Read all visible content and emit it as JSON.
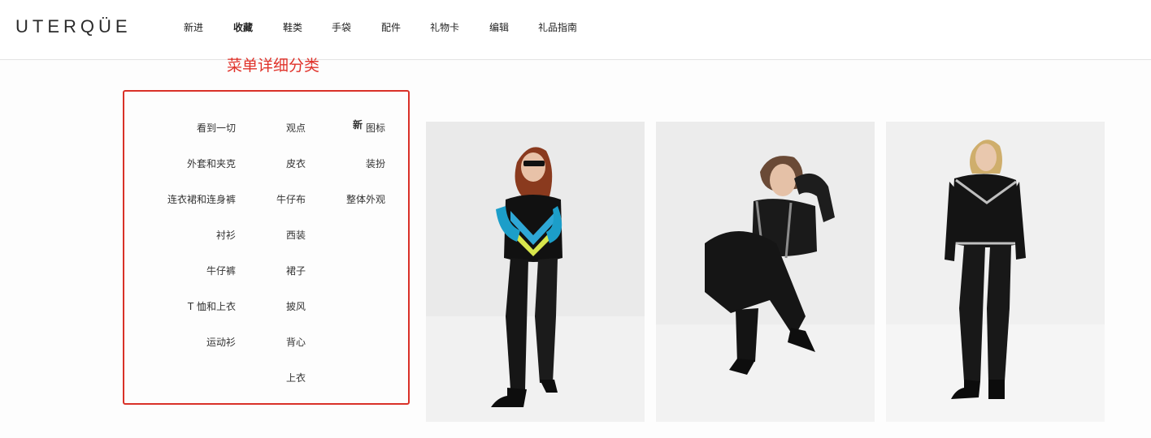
{
  "header": {
    "logo": "UTERQÜE",
    "nav": [
      {
        "label": "新进"
      },
      {
        "label": "收藏"
      },
      {
        "label": "鞋类"
      },
      {
        "label": "手袋"
      },
      {
        "label": "配件"
      },
      {
        "label": "礼物卡"
      },
      {
        "label": "编辑"
      },
      {
        "label": "礼品指南"
      }
    ],
    "active_nav": "收藏"
  },
  "annotation": {
    "text": "菜单详细分类",
    "color": "#e0322a"
  },
  "menu": {
    "col1": [
      "看到一切",
      "外套和夹克",
      "连衣裙和连身裤",
      "衬衫",
      "牛仔裤",
      "T 恤和上衣",
      "运动衫"
    ],
    "col2": [
      "观点",
      "皮衣",
      "牛仔布",
      "西装",
      "裙子",
      "披风",
      "背心",
      "上衣"
    ],
    "col3_new_tag": "新",
    "col3": [
      "图标",
      "装扮",
      "整体外观"
    ]
  },
  "photos": [
    {
      "name": "model-standing-colorful-sweater"
    },
    {
      "name": "model-crouching-black-outfit"
    },
    {
      "name": "model-standing-black-jacket"
    }
  ]
}
